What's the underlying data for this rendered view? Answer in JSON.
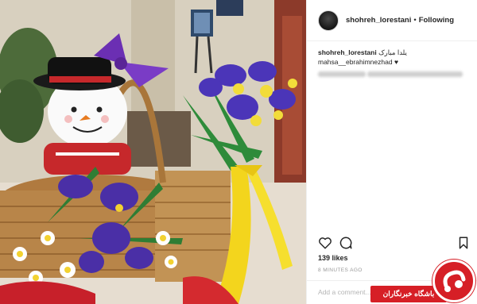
{
  "post": {
    "username": "shohreh_lorestani",
    "separator": "•",
    "follow_status": "Following",
    "caption_text": "یلدا مبارک",
    "tagged_user": "mahsa__ebrahimnezhad",
    "heart": "♥",
    "likes": "139 likes",
    "time": "8 MINUTES AGO",
    "comment_placeholder": "Add a comment..."
  },
  "icons": {
    "like": "heart-icon",
    "comment": "speech-bubble-icon",
    "save": "bookmark-icon"
  },
  "watermark": {
    "text": "باشگاه خبرنگاران"
  },
  "colors": {
    "text": "#262626",
    "muted": "#999999",
    "border": "#efefef",
    "watermark_red": "#d61f26"
  }
}
